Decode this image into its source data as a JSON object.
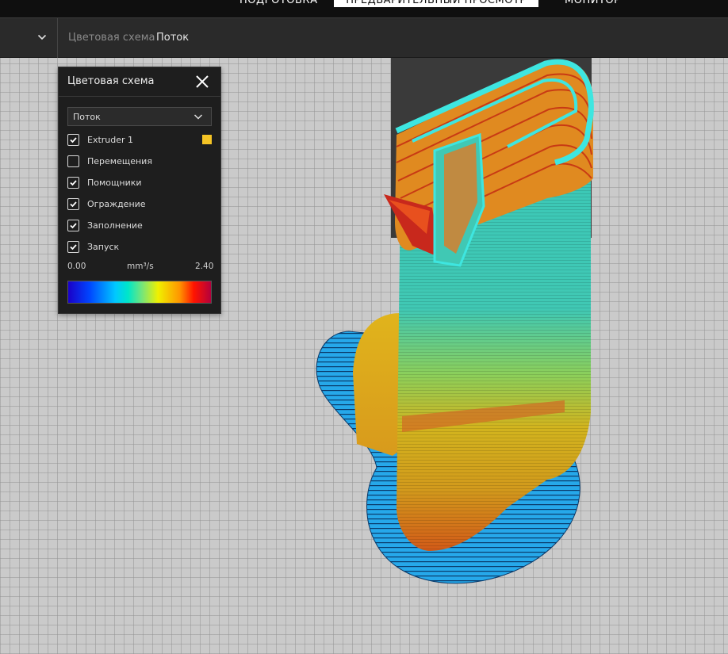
{
  "stages": {
    "prepare": "ПОДГОТОВКА",
    "preview": "ПРЕДВАРИТЕЛЬНЫЙ ПРОСМОТР",
    "monitor": "МОНИТОР"
  },
  "header": {
    "color_scheme_label": "Цветовая схема",
    "color_scheme_value": "Поток"
  },
  "panel": {
    "title": "Цветовая схема",
    "selected_scheme": "Поток",
    "extruder_color": "#f5c425",
    "items": [
      {
        "label": "Extruder 1",
        "checked": true
      },
      {
        "label": "Перемещения",
        "checked": false
      },
      {
        "label": "Помощники",
        "checked": true
      },
      {
        "label": "Ограждение",
        "checked": true
      },
      {
        "label": "Заполнение",
        "checked": true
      },
      {
        "label": "Запуск",
        "checked": true
      }
    ],
    "legend": {
      "min": "0.00",
      "unit": "mm³/s",
      "max": "2.40"
    }
  },
  "icons": {
    "view_dropdown": "chevron-down-icon",
    "select_arrow": "chevron-down-icon",
    "close": "close-icon",
    "check": "check-icon"
  }
}
